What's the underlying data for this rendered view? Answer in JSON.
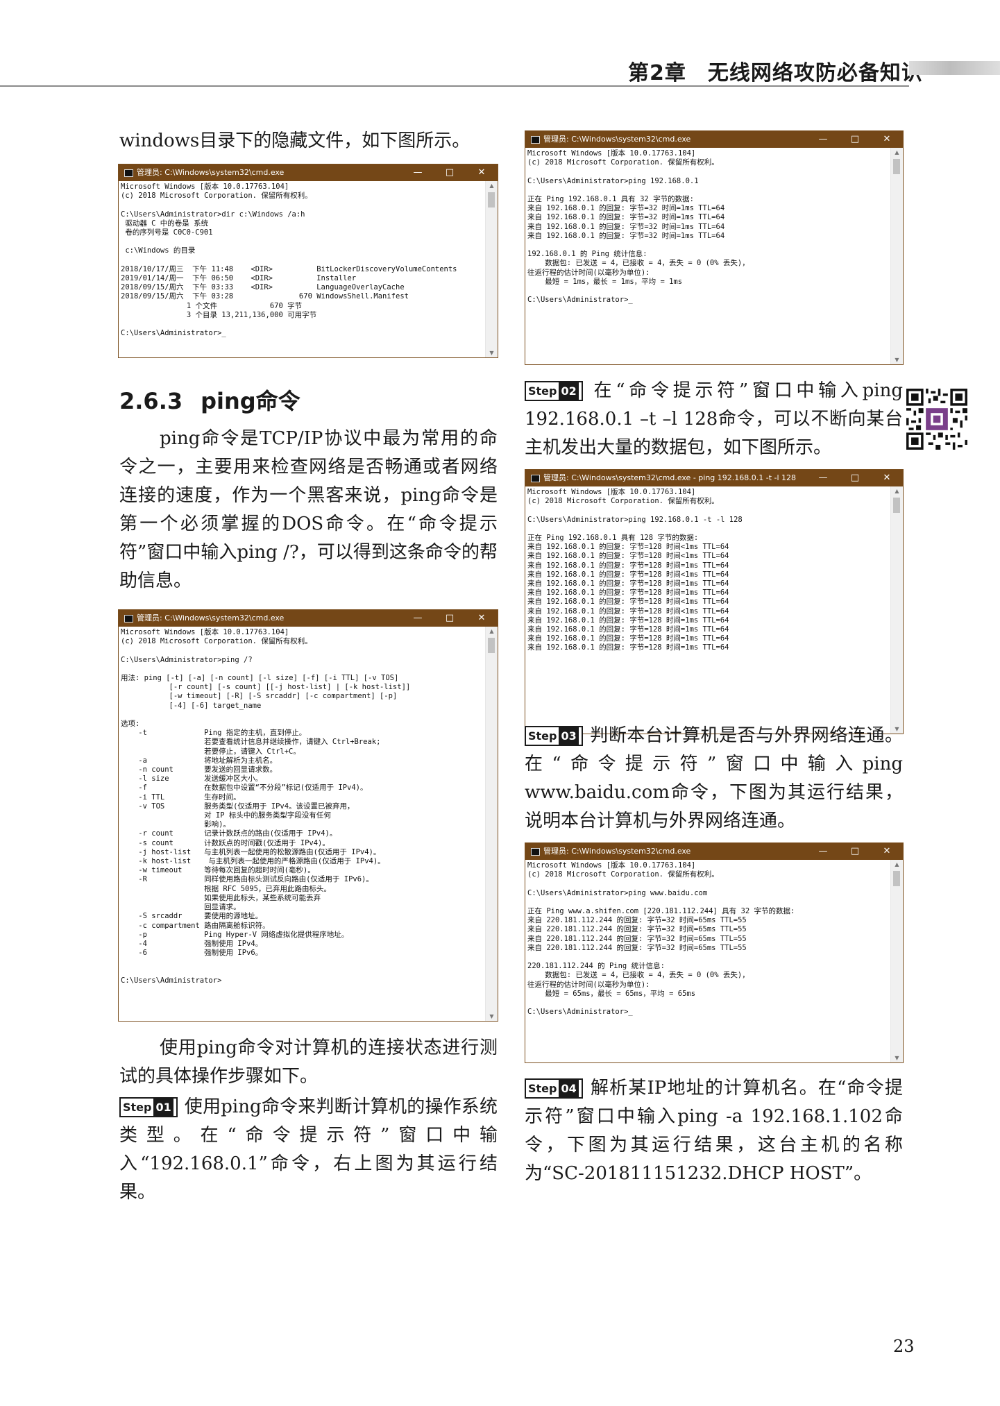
{
  "header": {
    "chapter": "第2章　无线网络攻防必备知识"
  },
  "intro_line": "windows目录下的隐藏文件，如下图所示。",
  "section": {
    "number": "2.6.3",
    "title": "ping命令"
  },
  "ping_intro": "ping命令是TCP/IP协议中最为常用的命令之一，主要用来检查网络是否畅通或者网络连接的速度，作为一个黑客来说，ping命令是第一个必须掌握的DOS命令。在“命令提示符”窗口中输入ping /?，可以得到这条命令的帮助信息。",
  "steps_intro": "使用ping命令对计算机的连接状态进行测试的具体操作步骤如下。",
  "steps": [
    {
      "label": "Step",
      "num": "01",
      "text": "使用ping命令来判断计算机的操作系统类型。在“命令提示符”窗口中输入“192.168.0.1”命令，右上图为其运行结果。"
    },
    {
      "label": "Step",
      "num": "02",
      "text": "在“命令提示符”窗口中输入ping 192.168.0.1 –t –l 128命令，可以不断向某台主机发出大量的数据包，如下图所示。"
    },
    {
      "label": "Step",
      "num": "03",
      "text": "判断本台计算机是否与外界网络连通。在“命令提示符”窗口中输入ping www.baidu.com命令，下图为其运行结果，说明本台计算机与外界网络连通。"
    },
    {
      "label": "Step",
      "num": "04",
      "text": "解析某IP地址的计算机名。在“命令提示符”窗口中输入ping -a 192.168.1.102命令，下图为其运行结果，这台主机的名称为“SC-201811151232.DHCP HOST”。"
    }
  ],
  "cmd_controls": {
    "min": "—",
    "max": "□",
    "close": "✕"
  },
  "cmd_windows": {
    "dir": {
      "title": "管理员: C:\\Windows\\system32\\cmd.exe",
      "text": "Microsoft Windows [版本 10.0.17763.104]\n(c) 2018 Microsoft Corporation. 保留所有权利。\n\nC:\\Users\\Administrator>dir c:\\Windows /a:h\n 驱动器 C 中的卷是 系统\n 卷的序列号是 C0C0-C901\n\n c:\\Windows 的目录\n\n2018/10/17/周三  下午 11:48    <DIR>          BitLockerDiscoveryVolumeContents\n2019/01/14/周一  下午 06:50    <DIR>          Installer\n2018/09/15/周六  下午 03:33    <DIR>          LanguageOverlayCache\n2018/09/15/周六  下午 03:28               670 WindowsShell.Manifest\n               1 个文件            670 字节\n               3 个目录 13,211,136,000 可用字节\n\nC:\\Users\\Administrator>_"
    },
    "ping_help": {
      "title": "管理员: C:\\Windows\\system32\\cmd.exe",
      "text": "Microsoft Windows [版本 10.0.17763.104]\n(c) 2018 Microsoft Corporation. 保留所有权利。\n\nC:\\Users\\Administrator>ping /?\n\n用法: ping [-t] [-a] [-n count] [-l size] [-f] [-i TTL] [-v TOS]\n           [-r count] [-s count] [[-j host-list] | [-k host-list]]\n           [-w timeout] [-R] [-S srcaddr] [-c compartment] [-p]\n           [-4] [-6] target_name\n\n选项:\n    -t             Ping 指定的主机，直到停止。\n                   若要查看统计信息并继续操作，请键入 Ctrl+Break;\n                   若要停止，请键入 Ctrl+C。\n    -a             将地址解析为主机名。\n    -n count       要发送的回显请求数。\n    -l size        发送缓冲区大小。\n    -f             在数据包中设置“不分段”标记(仅适用于 IPv4)。\n    -i TTL         生存时间。\n    -v TOS         服务类型(仅适用于 IPv4。该设置已被弃用，\n                   对 IP 标头中的服务类型字段没有任何\n                   影响)。\n    -r count       记录计数跃点的路由(仅适用于 IPv4)。\n    -s count       计数跃点的时间戳(仅适用于 IPv4)。\n    -j host-list   与主机列表一起使用的松散源路由(仅适用于 IPv4)。\n    -k host-list    与主机列表一起使用的严格源路由(仅适用于 IPv4)。\n    -w timeout     等待每次回复的超时时间(毫秒)。\n    -R             同样使用路由标头测试反向路由(仅适用于 IPv6)。\n                   根据 RFC 5095，已弃用此路由标头。\n                   如果使用此标头，某些系统可能丢弃\n                   回显请求。\n    -S srcaddr     要使用的源地址。\n    -c compartment 路由隔离舱标识符。\n    -p             Ping Hyper-V 网络虚拟化提供程序地址。\n    -4             强制使用 IPv4。\n    -6             强制使用 IPv6。\n\n\nC:\\Users\\Administrator>"
    },
    "ping_lan": {
      "title": "管理员: C:\\Windows\\system32\\cmd.exe",
      "text": "Microsoft Windows [版本 10.0.17763.104]\n(c) 2018 Microsoft Corporation. 保留所有权利。\n\nC:\\Users\\Administrator>ping 192.168.0.1\n\n正在 Ping 192.168.0.1 具有 32 字节的数据:\n来自 192.168.0.1 的回复: 字节=32 时间=1ms TTL=64\n来自 192.168.0.1 的回复: 字节=32 时间=1ms TTL=64\n来自 192.168.0.1 的回复: 字节=32 时间=1ms TTL=64\n来自 192.168.0.1 的回复: 字节=32 时间=1ms TTL=64\n\n192.168.0.1 的 Ping 统计信息:\n    数据包: 已发送 = 4，已接收 = 4，丢失 = 0 (0% 丢失)，\n往返行程的估计时间(以毫秒为单位):\n    最短 = 1ms，最长 = 1ms，平均 = 1ms\n\nC:\\Users\\Administrator>_"
    },
    "ping_t": {
      "title": "管理员: C:\\Windows\\system32\\cmd.exe - ping  192.168.0.1 -t -l 128",
      "text": "Microsoft Windows [版本 10.0.17763.104]\n(c) 2018 Microsoft Corporation. 保留所有权利。\n\nC:\\Users\\Administrator>ping 192.168.0.1 -t -l 128\n\n正在 Ping 192.168.0.1 具有 128 字节的数据:\n来自 192.168.0.1 的回复: 字节=128 时间<1ms TTL=64\n来自 192.168.0.1 的回复: 字节=128 时间<1ms TTL=64\n来自 192.168.0.1 的回复: 字节=128 时间=1ms TTL=64\n来自 192.168.0.1 的回复: 字节=128 时间<1ms TTL=64\n来自 192.168.0.1 的回复: 字节=128 时间=1ms TTL=64\n来自 192.168.0.1 的回复: 字节=128 时间=1ms TTL=64\n来自 192.168.0.1 的回复: 字节=128 时间<1ms TTL=64\n来自 192.168.0.1 的回复: 字节=128 时间<1ms TTL=64\n来自 192.168.0.1 的回复: 字节=128 时间=1ms TTL=64\n来自 192.168.0.1 的回复: 字节=128 时间=1ms TTL=64\n来自 192.168.0.1 的回复: 字节=128 时间=1ms TTL=64\n来自 192.168.0.1 的回复: 字节=128 时间=1ms TTL=64"
    },
    "ping_baidu": {
      "title": "管理员: C:\\Windows\\system32\\cmd.exe",
      "text": "Microsoft Windows [版本 10.0.17763.104]\n(c) 2018 Microsoft Corporation. 保留所有权利。\n\nC:\\Users\\Administrator>ping www.baidu.com\n\n正在 Ping www.a.shifen.com [220.181.112.244] 具有 32 字节的数据:\n来自 220.181.112.244 的回复: 字节=32 时间=65ms TTL=55\n来自 220.181.112.244 的回复: 字节=32 时间=65ms TTL=55\n来自 220.181.112.244 的回复: 字节=32 时间=65ms TTL=55\n来自 220.181.112.244 的回复: 字节=32 时间=65ms TTL=55\n\n220.181.112.244 的 Ping 统计信息:\n    数据包: 已发送 = 4，已接收 = 4，丢失 = 0 (0% 丢失)，\n往返行程的估计时间(以毫秒为单位):\n    最短 = 65ms，最长 = 65ms，平均 = 65ms\n\nC:\\Users\\Administrator>_"
    }
  },
  "page_number": "23"
}
